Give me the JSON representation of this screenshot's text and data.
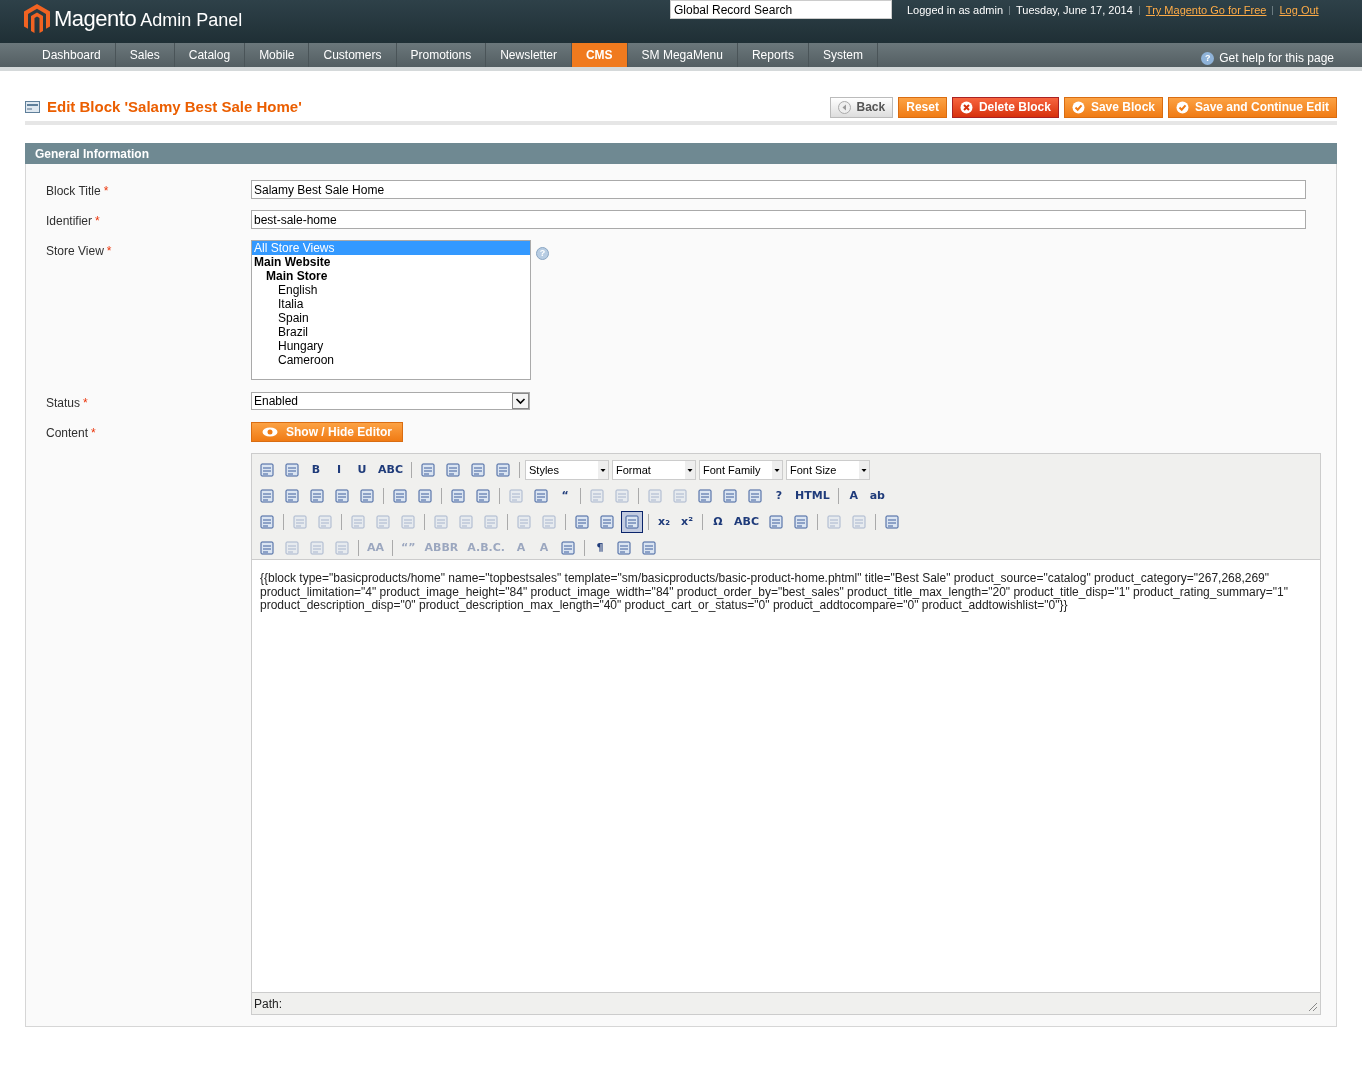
{
  "header": {
    "logo": "Magento",
    "logo_suffix": "Admin Panel",
    "search": {
      "value": "Global Record Search"
    },
    "user": "Logged in as admin",
    "date": "Tuesday, June 17, 2014",
    "links": [
      "Try Magento Go for Free",
      "Log Out"
    ]
  },
  "nav": {
    "items": [
      {
        "label": "Dashboard",
        "selected": false
      },
      {
        "label": "Sales",
        "selected": false
      },
      {
        "label": "Catalog",
        "selected": false
      },
      {
        "label": "Mobile",
        "selected": false
      },
      {
        "label": "Customers",
        "selected": false
      },
      {
        "label": "Promotions",
        "selected": false
      },
      {
        "label": "Newsletter",
        "selected": false
      },
      {
        "label": "CMS",
        "selected": true
      },
      {
        "label": "SM MegaMenu",
        "selected": false
      },
      {
        "label": "Reports",
        "selected": false
      },
      {
        "label": "System",
        "selected": false
      }
    ],
    "help_icon": "?",
    "help": "Get help for this page"
  },
  "page": {
    "title": "Edit Block 'Salamy Best Sale Home'",
    "buttons": [
      {
        "label": "Back",
        "kind": "back"
      },
      {
        "label": "Reset",
        "kind": "plain"
      },
      {
        "label": "Delete Block",
        "kind": "delete"
      },
      {
        "label": "Save Block",
        "kind": "save"
      },
      {
        "label": "Save and Continue Edit",
        "kind": "save"
      }
    ]
  },
  "section": {
    "title": "General Information",
    "fields": [
      {
        "kind": "text",
        "label": "Block Title",
        "required_mark": "*",
        "value": "Salamy Best Sale Home"
      },
      {
        "kind": "text",
        "label": "Identifier",
        "required_mark": "*",
        "value": "best-sale-home"
      },
      {
        "kind": "multiselect",
        "label": "Store View",
        "required_mark": "*",
        "help_icon": "?",
        "options": [
          {
            "label": "All Store Views",
            "selected": true
          },
          {
            "label": "Main Website",
            "selected": false,
            "children": [
              {
                "label": "Main Store",
                "selected": false,
                "children": [
                  {
                    "label": "English",
                    "selected": false
                  },
                  {
                    "label": "Italia",
                    "selected": false
                  },
                  {
                    "label": "Spain",
                    "selected": false
                  },
                  {
                    "label": "Brazil",
                    "selected": false
                  },
                  {
                    "label": "Hungary",
                    "selected": false
                  },
                  {
                    "label": "Cameroon",
                    "selected": false
                  }
                ]
              }
            ]
          }
        ]
      },
      {
        "kind": "select",
        "label": "Status",
        "required_mark": "*",
        "value": "Enabled"
      },
      {
        "kind": "editor",
        "label": "Content",
        "required_mark": "*",
        "toggle": "Show / Hide Editor",
        "toolbar": [
          [
            {
              "kind": "icon",
              "disabled": false
            },
            {
              "kind": "icon",
              "disabled": false
            },
            {
              "kind": "glyph",
              "glyph": "B",
              "disabled": false
            },
            {
              "kind": "glyph",
              "glyph": "I",
              "disabled": false
            },
            {
              "kind": "glyph",
              "glyph": "U",
              "disabled": false
            },
            {
              "kind": "glyph",
              "glyph": "ABC",
              "disabled": false
            },
            {
              "kind": "sep"
            },
            {
              "kind": "icon",
              "disabled": false
            },
            {
              "kind": "icon",
              "disabled": false
            },
            {
              "kind": "icon",
              "disabled": false
            },
            {
              "kind": "icon",
              "disabled": false
            },
            {
              "kind": "sep"
            },
            {
              "kind": "dropdown",
              "label": "Styles"
            },
            {
              "kind": "dropdown",
              "label": "Format"
            },
            {
              "kind": "dropdown",
              "label": "Font Family"
            },
            {
              "kind": "dropdown",
              "label": "Font Size"
            }
          ],
          [
            {
              "kind": "icon",
              "disabled": false
            },
            {
              "kind": "icon",
              "disabled": false
            },
            {
              "kind": "icon",
              "disabled": false
            },
            {
              "kind": "icon",
              "disabled": false
            },
            {
              "kind": "icon",
              "disabled": false
            },
            {
              "kind": "sep"
            },
            {
              "kind": "icon",
              "disabled": false
            },
            {
              "kind": "icon",
              "disabled": false
            },
            {
              "kind": "sep"
            },
            {
              "kind": "icon",
              "disabled": false
            },
            {
              "kind": "icon",
              "disabled": false
            },
            {
              "kind": "sep"
            },
            {
              "kind": "icon",
              "disabled": true
            },
            {
              "kind": "icon",
              "disabled": false
            },
            {
              "kind": "glyph",
              "glyph": "“",
              "disabled": false
            },
            {
              "kind": "sep"
            },
            {
              "kind": "icon",
              "disabled": true
            },
            {
              "kind": "icon",
              "disabled": true
            },
            {
              "kind": "sep"
            },
            {
              "kind": "icon",
              "disabled": true
            },
            {
              "kind": "icon",
              "disabled": true
            },
            {
              "kind": "icon",
              "disabled": false
            },
            {
              "kind": "icon",
              "disabled": false
            },
            {
              "kind": "icon",
              "disabled": false
            },
            {
              "kind": "glyph",
              "glyph": "?",
              "disabled": false
            },
            {
              "kind": "glyph",
              "glyph": "HTML",
              "disabled": false
            },
            {
              "kind": "sep"
            },
            {
              "kind": "glyph",
              "glyph": "A",
              "disabled": false
            },
            {
              "kind": "glyph",
              "glyph": "ab",
              "disabled": false
            }
          ],
          [
            {
              "kind": "icon",
              "disabled": false
            },
            {
              "kind": "sep"
            },
            {
              "kind": "icon",
              "disabled": true
            },
            {
              "kind": "icon",
              "disabled": true
            },
            {
              "kind": "sep"
            },
            {
              "kind": "icon",
              "disabled": true
            },
            {
              "kind": "icon",
              "disabled": true
            },
            {
              "kind": "icon",
              "disabled": true
            },
            {
              "kind": "sep"
            },
            {
              "kind": "icon",
              "disabled": true
            },
            {
              "kind": "icon",
              "disabled": true
            },
            {
              "kind": "icon",
              "disabled": true
            },
            {
              "kind": "sep"
            },
            {
              "kind": "icon",
              "disabled": true
            },
            {
              "kind": "icon",
              "disabled": true
            },
            {
              "kind": "sep"
            },
            {
              "kind": "icon",
              "disabled": false
            },
            {
              "kind": "icon",
              "disabled": false
            },
            {
              "kind": "icon",
              "disabled": false,
              "selected": true
            },
            {
              "kind": "sep"
            },
            {
              "kind": "glyph",
              "glyph": "x₂",
              "disabled": false
            },
            {
              "kind": "glyph",
              "glyph": "x²",
              "disabled": false
            },
            {
              "kind": "sep"
            },
            {
              "kind": "glyph",
              "glyph": "Ω",
              "disabled": false
            },
            {
              "kind": "glyph",
              "glyph": "ABC",
              "disabled": false
            },
            {
              "kind": "icon",
              "disabled": false
            },
            {
              "kind": "icon",
              "disabled": false
            },
            {
              "kind": "sep"
            },
            {
              "kind": "icon",
              "disabled": true
            },
            {
              "kind": "icon",
              "disabled": true
            },
            {
              "kind": "sep"
            },
            {
              "kind": "icon",
              "disabled": false
            }
          ],
          [
            {
              "kind": "icon",
              "disabled": false
            },
            {
              "kind": "icon",
              "disabled": true
            },
            {
              "kind": "icon",
              "disabled": true
            },
            {
              "kind": "icon",
              "disabled": true
            },
            {
              "kind": "sep"
            },
            {
              "kind": "glyph",
              "glyph": "AA",
              "disabled": true
            },
            {
              "kind": "sep"
            },
            {
              "kind": "glyph",
              "glyph": "“”",
              "disabled": true
            },
            {
              "kind": "glyph",
              "glyph": "ABBR",
              "disabled": true
            },
            {
              "kind": "glyph",
              "glyph": "A.B.C.",
              "disabled": true
            },
            {
              "kind": "glyph",
              "glyph": "A",
              "disabled": true
            },
            {
              "kind": "glyph",
              "glyph": "A",
              "disabled": true
            },
            {
              "kind": "icon",
              "disabled": false
            },
            {
              "kind": "sep"
            },
            {
              "kind": "glyph",
              "glyph": "¶",
              "disabled": false
            },
            {
              "kind": "icon",
              "disabled": false
            },
            {
              "kind": "icon",
              "disabled": false
            }
          ]
        ],
        "content": "{{block type=\"basicproducts/home\" name=\"topbestsales\" template=\"sm/basicproducts/basic-product-home.phtml\" title=\"Best Sale\" product_source=\"catalog\" product_category=\"267,268,269\" product_limitation=\"4\" product_image_height=\"84\" product_image_width=\"84\" product_order_by=\"best_sales\" product_title_max_length=\"20\" product_title_disp=\"1\" product_rating_summary=\"1\" product_description_disp=\"0\" product_description_max_length=\"40\" product_cart_or_status=\"0\" product_addtocompare=\"0\" product_addtowishlist=\"0\"}}",
        "path": "Path:"
      }
    ]
  }
}
